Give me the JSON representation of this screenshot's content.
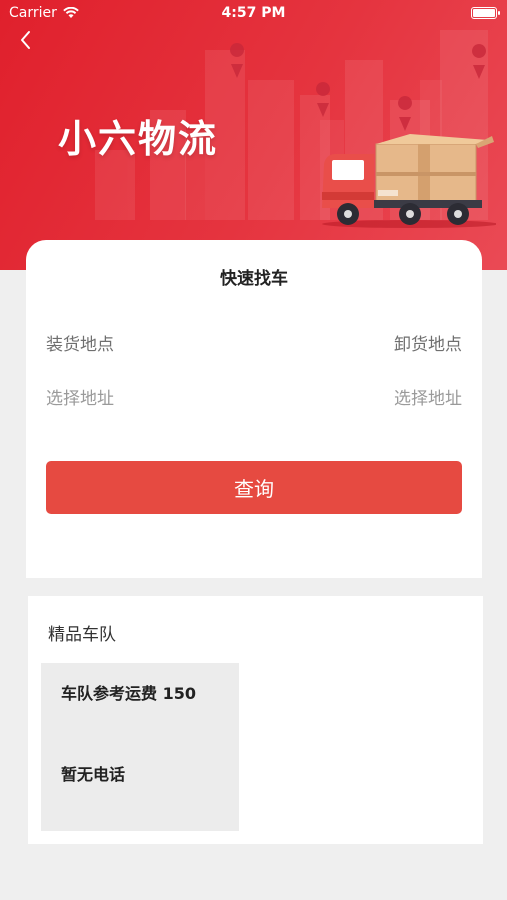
{
  "status": {
    "carrier": "Carrier",
    "time": "4:57 PM"
  },
  "header": {
    "brand": "小六物流"
  },
  "search": {
    "title": "快速找车",
    "load_label": "装货地点",
    "unload_label": "卸货地点",
    "load_placeholder": "选择地址",
    "unload_placeholder": "选择地址",
    "query_button": "查询"
  },
  "fleet": {
    "section_title": "精品车队",
    "items": [
      {
        "price_text": "车队参考运费 150",
        "phone_text": "暂无电话"
      }
    ]
  },
  "colors": {
    "hero_red": "#e0202c",
    "button_red": "#e64a41",
    "page_bg": "#efefef"
  },
  "icons": [
    "wifi-icon",
    "battery-icon",
    "back-arrow-icon",
    "location-pin-icon",
    "truck-illustration"
  ]
}
